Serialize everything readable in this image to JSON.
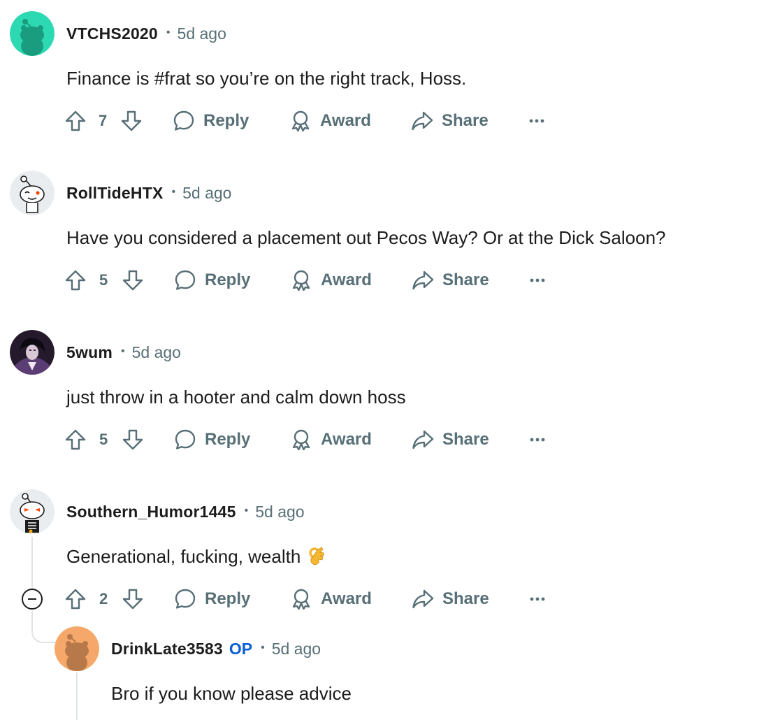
{
  "actions": {
    "reply": "Reply",
    "award": "Award",
    "share": "Share"
  },
  "comments": [
    {
      "username": "VTCHS2020",
      "time": "5d ago",
      "body": "Finance is #frat so you’re on the right track, Hoss.",
      "votes": "7",
      "avatar": "teal-snoo-avatar"
    },
    {
      "username": "RollTideHTX",
      "time": "5d ago",
      "body": "Have you considered a placement out Pecos Way? Or at the Dick Saloon?",
      "votes": "5",
      "avatar": "winking-snoo-avatar"
    },
    {
      "username": "5wum",
      "time": "5d ago",
      "body": "just throw in a hooter and calm down hoss",
      "votes": "5",
      "avatar": "anime-character-avatar"
    },
    {
      "username": "Southern_Humor1445",
      "time": "5d ago",
      "body": "Generational, fucking, wealth",
      "votes": "2",
      "avatar": "skeleton-snoo-avatar",
      "emoji": "ok-hand-emoji"
    },
    {
      "username": "DrinkLate3583",
      "op_label": "OP",
      "time": "5d ago",
      "body": "Bro if you know please advice",
      "avatar": "orange-snoo-avatar"
    }
  ],
  "colors": {
    "meta_gray": "#576f76",
    "op_blue": "#0a5fd6",
    "thread_line": "#e0e4e6",
    "teal_avatar": "#2dd9b3",
    "orange_avatar": "#f5a86a"
  }
}
